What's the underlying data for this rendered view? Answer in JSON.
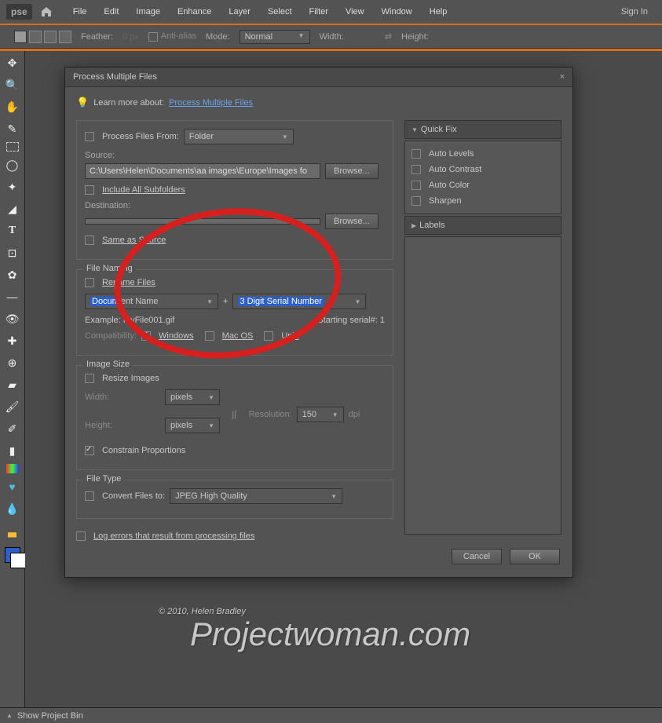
{
  "app": {
    "logo": "pse",
    "signin": "Sign In"
  },
  "menu": [
    "File",
    "Edit",
    "Image",
    "Enhance",
    "Layer",
    "Select",
    "Filter",
    "View",
    "Window",
    "Help"
  ],
  "toolbar": {
    "feather_label": "Feather:",
    "feather_val": "0 px",
    "antialias": "Anti-alias",
    "mode_label": "Mode:",
    "mode_val": "Normal",
    "width_label": "Width:",
    "height_label": "Height:"
  },
  "dialog": {
    "title": "Process Multiple Files",
    "hint_label": "Learn more about:",
    "hint_link": "Process Multiple Files",
    "process_from_label": "Process Files From:",
    "process_from_val": "Folder",
    "source_label": "Source:",
    "source_path": "C:\\Users\\Helen\\Documents\\aa images\\Europe\\Images fo",
    "browse": "Browse...",
    "include_sub": "Include All Subfolders",
    "dest_label": "Destination:",
    "dest_path": "",
    "same_as_source": "Same as Source",
    "naming": {
      "legend": "File Naming",
      "rename": "Rename Files",
      "part1_hilite": "Docum",
      "part1_rest": "ent Name",
      "plus": "+",
      "part2": "3 Digit Serial Number",
      "example_label": "Example:",
      "example_val": "MyFile001.gif",
      "serial_label": "Starting serial#:",
      "serial_val": "1",
      "compat_label": "Compatibility:",
      "compat_win": "Windows",
      "compat_mac": "Mac OS",
      "compat_unix": "Unix"
    },
    "size": {
      "legend": "Image Size",
      "resize": "Resize Images",
      "width": "Width:",
      "height": "Height:",
      "unit": "pixels",
      "res_label": "Resolution:",
      "res_val": "150",
      "dpi": "dpi",
      "constrain": "Constrain Proportions"
    },
    "type": {
      "legend": "File Type",
      "convert": "Convert Files to:",
      "format": "JPEG High Quality"
    },
    "log": "Log errors that result from processing files",
    "quickfix": {
      "header": "Quick Fix",
      "items": [
        "Auto Levels",
        "Auto Contrast",
        "Auto Color",
        "Sharpen"
      ]
    },
    "labels_header": "Labels",
    "cancel": "Cancel",
    "ok": "OK"
  },
  "watermark": {
    "l1": "© 2010, Helen Bradley",
    "l2": "Projectwoman.com"
  },
  "status": {
    "text": "Show Project Bin"
  }
}
